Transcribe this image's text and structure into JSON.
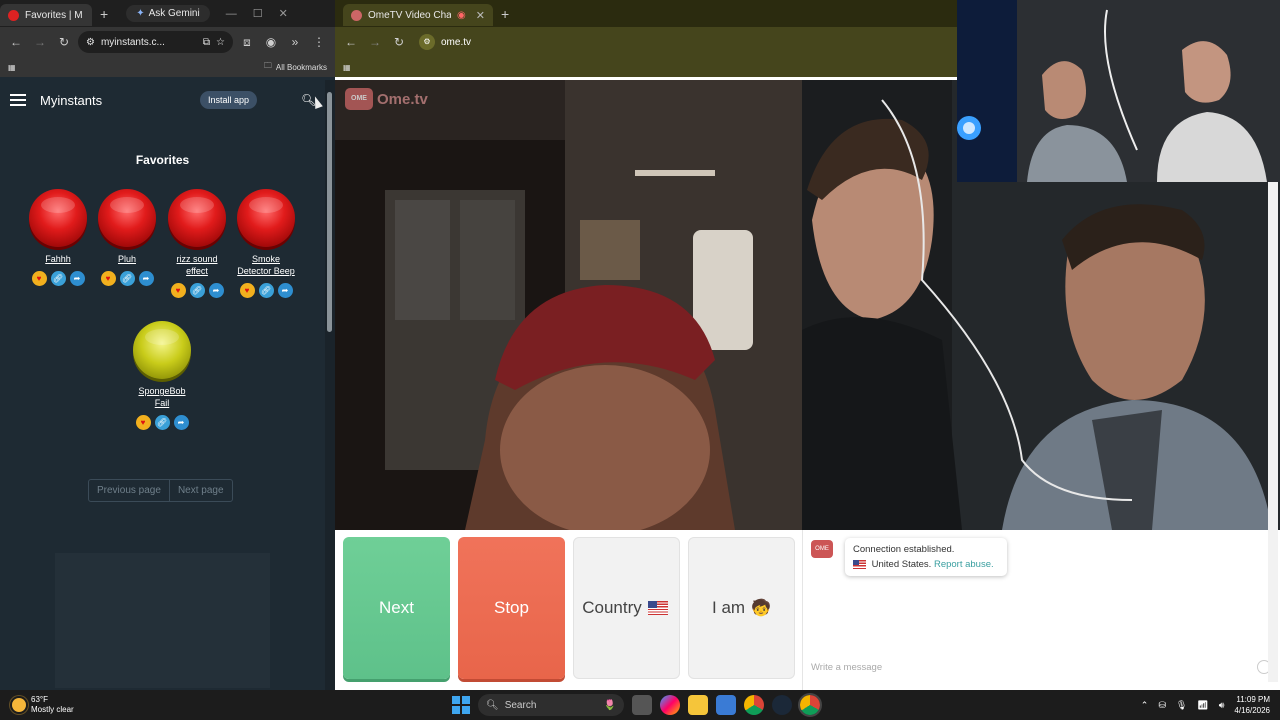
{
  "left_browser": {
    "tab_title": "Favorites | M",
    "gemini_label": "Ask Gemini",
    "url": "myinstants.c...",
    "bookmarks_label": "All Bookmarks"
  },
  "myinstants": {
    "title": "Myinstants",
    "install_label": "Install app",
    "favorites_heading": "Favorites",
    "instants": [
      {
        "label": "Fahhh",
        "color": "red"
      },
      {
        "label": "Pluh",
        "color": "red"
      },
      {
        "label": "rizz sound effect",
        "color": "red"
      },
      {
        "label": "Smoke Detector Beep",
        "color": "red"
      },
      {
        "label": "SpongeBob Fail",
        "color": "yellow"
      }
    ],
    "prev_page": "Previous page",
    "next_page": "Next page"
  },
  "right_browser": {
    "tab_title": "OmeTV Video Chat — Ome",
    "url": "ome.tv"
  },
  "ometv": {
    "logo_text": "Ome.tv",
    "next_label": "Next",
    "stop_label": "Stop",
    "country_label": "Country",
    "iam_label": "I am",
    "chat_status": "Connection established.",
    "chat_country": "United States.",
    "chat_report": "Report abuse.",
    "message_placeholder": "Write a message"
  },
  "taskbar": {
    "temperature": "63°F",
    "weather": "Mostly clear",
    "search_label": "Search",
    "time": "11:09 PM",
    "date": "4/16/2026"
  },
  "colors": {
    "next_green": "#5ec18a",
    "stop_red": "#e8654a",
    "page_bg": "#1e2a33"
  }
}
